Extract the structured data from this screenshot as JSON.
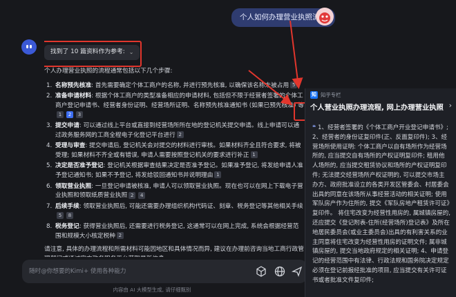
{
  "user_message": "个人如何办理营业执照流程",
  "refs_chip": {
    "label": "找到了 10 篇资料作为参考:",
    "chevron": "chevron-down"
  },
  "answer": {
    "intro": "个人办理营业执照的流程通常包括以下几个步骤:",
    "steps": [
      {
        "num": "1.",
        "title": "名称预先核准",
        "text": ": 首先需要确定个体工商户的名称, 并进行预先核准, 以确保该名称未被占用",
        "cites": [
          "5"
        ]
      },
      {
        "num": "2.",
        "title": "准备申请材料",
        "text": ": 根据个体工商户的类型准备相应的申请材料, 包括但不限于经营者签署的个体工商户登记申请书、经营者身份证明、经营场所证明、名称预先核准通知书 (如果已预先核准) 等",
        "cites": [
          "1",
          "2",
          "3"
        ]
      },
      {
        "num": "3.",
        "title": "提交申请",
        "text": ": 可以通过线上平台或直接到经营场所所在地的登记机关提交申请。线上申请可以通过政务服务网的工商全程电子化登记平台进行",
        "cites": [
          "2"
        ]
      },
      {
        "num": "4.",
        "title": "受理与审查",
        "text": ": 提交申请后, 登记机关会对提交的材料进行审核。如果材料齐全且符合要求, 将被受理; 如果材料不齐全或有错误, 申请人需要按照登记机关的要求进行补正",
        "cites": [
          "1"
        ]
      },
      {
        "num": "5.",
        "title": "决定是否准予登记",
        "text": ": 登记机关根据审查结果决定是否准予登记。如果准予登记, 将发给申请人准予登记通知书; 如果不予登记, 将发给驳回通知书并说明理由",
        "cites": [
          "1"
        ]
      },
      {
        "num": "6.",
        "title": "领取营业执照",
        "text": ": 一旦登记申请被核准, 申请人可以领取营业执照。现在也可以在网上下载电子营业执照和领取纸质营业执照",
        "cites": [
          "2",
          "4"
        ]
      },
      {
        "num": "7.",
        "title": "后续手续",
        "text": ": 领取营业执照后, 可能还需要办理组织机构代码证、刻章、税务登记等其他相关手续",
        "cites": [
          "5",
          "8"
        ]
      },
      {
        "num": "8.",
        "title": "税务登记",
        "text": ": 获得营业执照后, 还需要进行税务登记, 这通常可以在网上完成, 系统会根据经营范围和规模大小核定税种",
        "cites": [
          "2"
        ]
      }
    ],
    "closing": "请注意, 具体的办理流程和所需材料可能因地区和具体情况而异, 建议在办理前咨询当地工商行政管理部门或通过官方政务服务平台获取最新信息。"
  },
  "input": {
    "placeholder": "随时@你想要的Kimi+ 使用各种能力"
  },
  "input_tools": [
    "cube-icon",
    "globe-icon",
    "send-icon"
  ],
  "disclaimer": "内容由 AI 大模型生成, 请仔细甄别",
  "source_popup": {
    "source_name": "知乎专栏",
    "logo_letter": "知",
    "title": "个人营业执照办理流程, 网上办理营业执照",
    "quote_mark": "❝",
    "excerpt": "1、经营者签署的《个体工商户开业登记申请书》; 2、经营者的身份证复印件(正、反面复印件); 3、经营场所使用证明: 个体工商户以自有场所作为经营场所的, 应当提交自有场所的产权证明复印件; 租用他人场所的, 应当提交租赁协议和场所的产权证明复印件; 无法提交经营场所产权证明的, 可以提交市场主办方、政府批准设立的各类开发区管委会、村居委会出具的同意在该场所从事经营活动的相关证明; 使用军队房产作为住所的, 提交《军队房地产租赁许可证》复印件。 将住宅改变为经营性用房的, 属城镇房屋的, 还应提交《登记附表-住所(经营场所)登记表》及所在地居民委员会(或业主委员会)出具的有利害关系的业主同意将住宅改变为经营性用房的证明文件; 属非城镇房屋的, 提交当地政府规定的相关证明; 4、申请登记的经营范围中有法律、行政法规和国务院决定规定必须在登记前报经批准的项目, 应当提交有关许可证书或者批准文件复印件;"
  },
  "colors": {
    "background": "#17181c",
    "user_bubble": "#2f3c70",
    "accent": "#3c6df0",
    "highlight_red": "#e2362d",
    "popup_bg": "#1e2026"
  }
}
